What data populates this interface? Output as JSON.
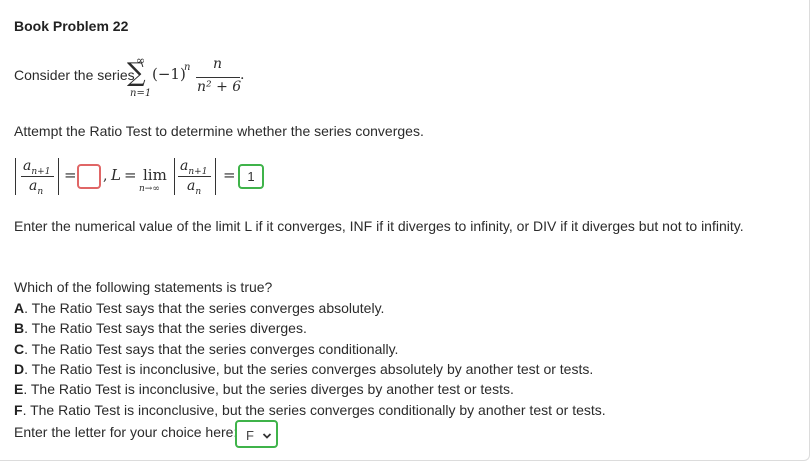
{
  "problem": {
    "title": "Book Problem 22",
    "intro_text": "Consider the series",
    "series": {
      "sum_upper": "∞",
      "sum_lower": "n=1",
      "factor": "(−1)",
      "exponent": "n",
      "numerator": "n",
      "denominator": "n² + 6",
      "end_punct": "."
    },
    "instruction": "Attempt the Ratio Test to determine whether the series converges."
  },
  "ratio": {
    "num": "a",
    "num_sub": "n+1",
    "den": "a",
    "den_sub": "n",
    "eq1": "=",
    "answer1_value": "",
    "comma": ",",
    "L_label": "L",
    "eq2": "=",
    "lim_word": "lim",
    "lim_sub": "n→∞",
    "eq3": "=",
    "answer2_value": "1"
  },
  "limit_instruction": "Enter the numerical value of the limit L if it converges, INF if it diverges to infinity, or DIV if it diverges but not to infinity.",
  "question": {
    "prompt": "Which of the following statements is true?",
    "options": [
      {
        "letter": "A",
        "text": ". The Ratio Test says that the series converges absolutely."
      },
      {
        "letter": "B",
        "text": ". The Ratio Test says that the series diverges."
      },
      {
        "letter": "C",
        "text": ". The Ratio Test says that the series converges conditionally."
      },
      {
        "letter": "D",
        "text": ". The Ratio Test is inconclusive, but the series converges absolutely by another test or tests."
      },
      {
        "letter": "E",
        "text": ". The Ratio Test is inconclusive, but the series diverges by another test or tests."
      },
      {
        "letter": "F",
        "text": ". The Ratio Test is inconclusive, but the series converges conditionally by another test or tests."
      }
    ],
    "choice_label": "Enter the letter for your choice here:",
    "choice_value": "F"
  },
  "colors": {
    "error_border": "#e06666",
    "correct_border": "#3fb34a",
    "text": "#2b2b2b"
  }
}
